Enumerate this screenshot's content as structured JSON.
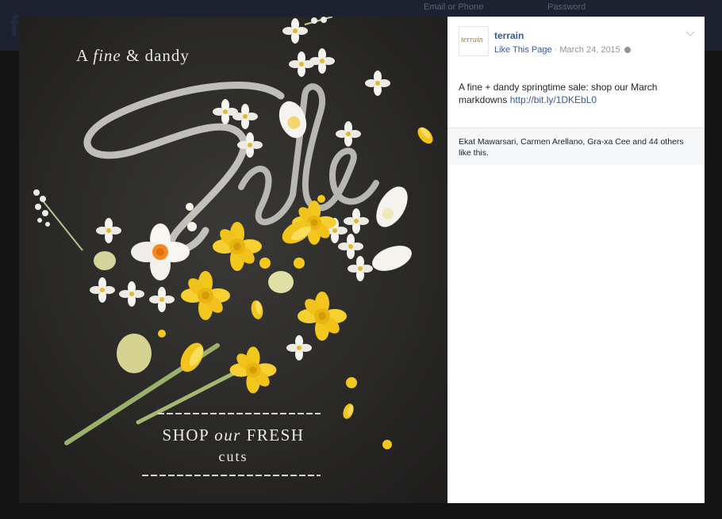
{
  "background_header": {
    "email_label": "Email or Phone",
    "password_label": "Password"
  },
  "photo": {
    "headline_pre": "A ",
    "headline_italic": "fine",
    "headline_post": " & dandy",
    "script_word": "Sale",
    "cta_line1_a": "SHOP ",
    "cta_line1_italic": "our",
    "cta_line1_b": " FRESH",
    "cta_line2": "cuts"
  },
  "post": {
    "page_name": "terrain",
    "avatar_text": "terrain",
    "like_page": "Like This Page",
    "separator": " · ",
    "date": "March 24, 2015",
    "text": "A fine + dandy springtime sale: shop our March markdowns ",
    "link": "http://bit.ly/1DKEbL0",
    "likes": "Ekat Mawarsari, Carmen Arellano, Gra-xa Cee and 44 others like this."
  },
  "colors": {
    "facebook_link": "#365899",
    "chalkboard": "#2b2a29",
    "daffodil_yellow": "#f2c81e"
  }
}
